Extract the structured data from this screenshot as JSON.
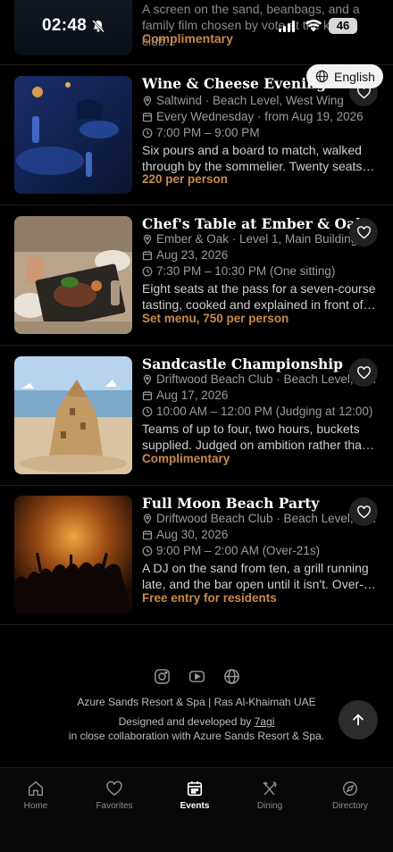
{
  "status_bar": {
    "time": "02:48",
    "battery": "46"
  },
  "language": {
    "label": "English"
  },
  "partial_event": {
    "description": "A screen on the sand, beanbags, and a family film chosen by vote at the kids club...",
    "price": "Complimentary"
  },
  "events": [
    {
      "title": "Wine & Cheese Evening",
      "location": "Saltwind · Beach Level, West Wing",
      "date": "Every Wednesday · from Aug 19, 2026",
      "time": "7:00 PM – 9:00 PM",
      "description_line1": "Six pours and a board to match, walked",
      "description_line2": "through by the sommelier. Twenty seats at...",
      "price": "220 per person"
    },
    {
      "title": "Chef's Table at Ember & Oak",
      "location": "Ember & Oak · Level 1, Main Building",
      "date": "Aug 23, 2026",
      "time": "7:30 PM – 10:30 PM (One sitting)",
      "description_line1": "Eight seats at the pass for a seven-course",
      "description_line2": "tasting, cooked and explained in front of yo...",
      "price": "Set menu, 750 per person"
    },
    {
      "title": "Sandcastle Championship",
      "location": "Driftwood Beach Club · Beach Level, East...",
      "date": "Aug 17, 2026",
      "time": "10:00 AM – 12:00 PM (Judging at 12:00)",
      "description_line1": "Teams of up to four, two hours, buckets",
      "description_line2": "supplied. Judged on ambition rather than...",
      "price": "Complimentary"
    },
    {
      "title": "Full Moon Beach Party",
      "location": "Driftwood Beach Club · Beach Level, East...",
      "date": "Aug 30, 2026",
      "time": "9:00 PM – 2:00 AM (Over-21s)",
      "description_line1": "A DJ on the sand from ten, a grill running",
      "description_line2": "late, and the bar open until it isn't. Over-21s...",
      "price": "Free entry for residents"
    }
  ],
  "footer": {
    "resort": "Azure Sands Resort & Spa | Ras Al-Khaimah UAE",
    "designed_by_prefix": "Designed and developed by ",
    "designed_by_link": "7agi",
    "collaboration": "in close collaboration with Azure Sands Resort & Spa."
  },
  "nav": [
    {
      "label": "Home",
      "icon": "home-icon"
    },
    {
      "label": "Favorites",
      "icon": "heart-icon"
    },
    {
      "label": "Events",
      "icon": "calendar-icon",
      "active": true
    },
    {
      "label": "Dining",
      "icon": "utensils-icon"
    },
    {
      "label": "Directory",
      "icon": "compass-icon"
    }
  ],
  "colors": {
    "accent": "#c98a4b",
    "background": "#000000",
    "muted": "#9c9c9c"
  }
}
